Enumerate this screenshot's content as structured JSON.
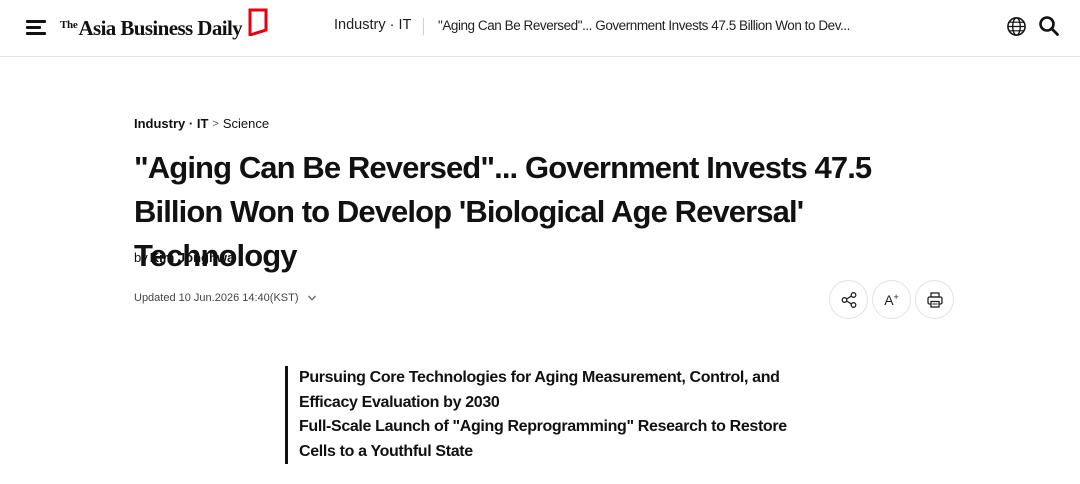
{
  "header": {
    "menu_icon": "hamburger-menu-icon",
    "logo": {
      "prefix": "The",
      "name": "Asia Business Daily",
      "mark_color": "#e60012"
    },
    "section": "Industry · IT",
    "article_title_short": "\"Aging Can Be Reversed\"... Government Invests 47.5 Billion Won to Dev...",
    "globe_icon": "globe-icon",
    "search_icon": "search-icon"
  },
  "article": {
    "breadcrumb": {
      "category": "Industry · IT",
      "separator": ">",
      "subcategory": "Science"
    },
    "headline": "\"Aging Can Be Reversed\"... Government Invests 47.5 Billion Won to Develop 'Biological Age Reversal' Technology",
    "byline": {
      "prefix": "by",
      "author": "Kim Jonghwa"
    },
    "updated": "Updated 10 Jun.2026 14:40(KST)",
    "tools": {
      "share_icon": "share-icon",
      "font_size_label": "A",
      "font_size_sup": "+",
      "print_icon": "printer-icon"
    },
    "summary": [
      "Pursuing Core Technologies for Aging Measurement, Control, and Efficacy Evaluation by 2030",
      "Full-Scale Launch of \"Aging Reprogramming\" Research to Restore Cells to a Youthful State"
    ]
  }
}
